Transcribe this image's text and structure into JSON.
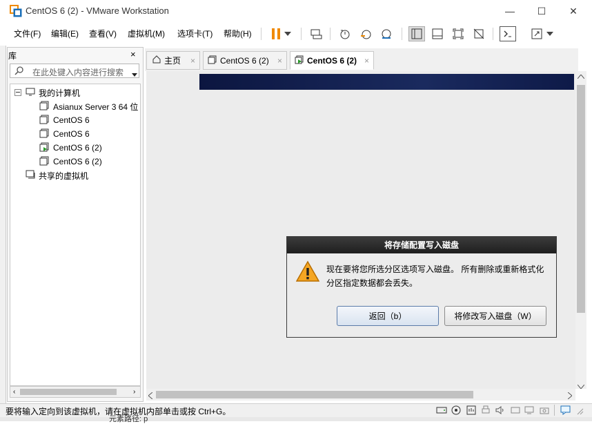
{
  "window": {
    "title": "CentOS 6 (2) - VMware Workstation",
    "minimize": "—",
    "maximize": "☐",
    "close": "✕"
  },
  "menu": [
    "文件(F)",
    "编辑(E)",
    "查看(V)",
    "虚拟机(M)",
    "选项卡(T)",
    "帮助(H)"
  ],
  "library": {
    "title": "库",
    "close": "×",
    "search_placeholder": "在此处键入内容进行搜索",
    "tree": {
      "my_computer": "我的计算机",
      "items": [
        "Asianux Server 3 64 位",
        "CentOS 6",
        "CentOS 6",
        "CentOS 6 (2)",
        "CentOS 6 (2)"
      ],
      "shared": "共享的虚拟机"
    }
  },
  "tabs": [
    {
      "label": "主页",
      "icon": "home-icon",
      "active": false
    },
    {
      "label": "CentOS 6 (2)",
      "icon": "vm-icon",
      "active": false
    },
    {
      "label": "CentOS 6 (2)",
      "icon": "vm-running-icon",
      "active": true
    }
  ],
  "tab_close": "×",
  "dialog": {
    "title": "将存储配置写入磁盘",
    "message": "现在要将您所选分区选项写入磁盘。 所有删除或重新格式化分区指定数据都会丢失。",
    "back_button": "返回（b）",
    "write_button": "将修改写入磁盘（W）"
  },
  "status": {
    "text": "要将输入定向到该虚拟机，请在虚拟机内部单击或按 Ctrl+G。",
    "bottom": "元素路径: p"
  },
  "colors": {
    "accent_orange": "#f08a00",
    "dialog_title_bg": "#2a2a2a",
    "vm_banner": "#0f1a4a"
  }
}
